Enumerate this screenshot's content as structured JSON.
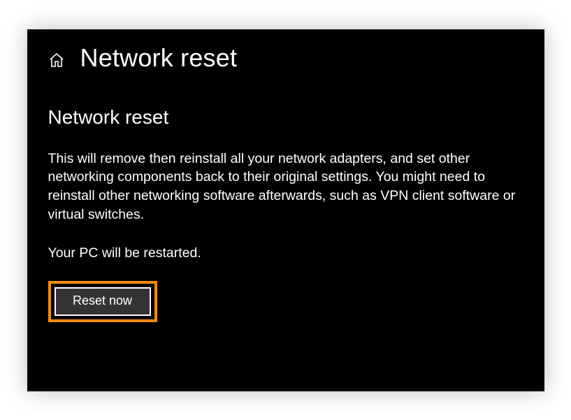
{
  "header": {
    "page_title": "Network reset"
  },
  "main": {
    "section_title": "Network reset",
    "description": "This will remove then reinstall all your network adapters, and set other networking components back to their original settings. You might need to reinstall other networking software afterwards, such as VPN client software or virtual switches.",
    "restart_note": "Your PC will be restarted.",
    "reset_button_label": "Reset now"
  },
  "annotation": {
    "highlight_color": "#ff8c00"
  }
}
